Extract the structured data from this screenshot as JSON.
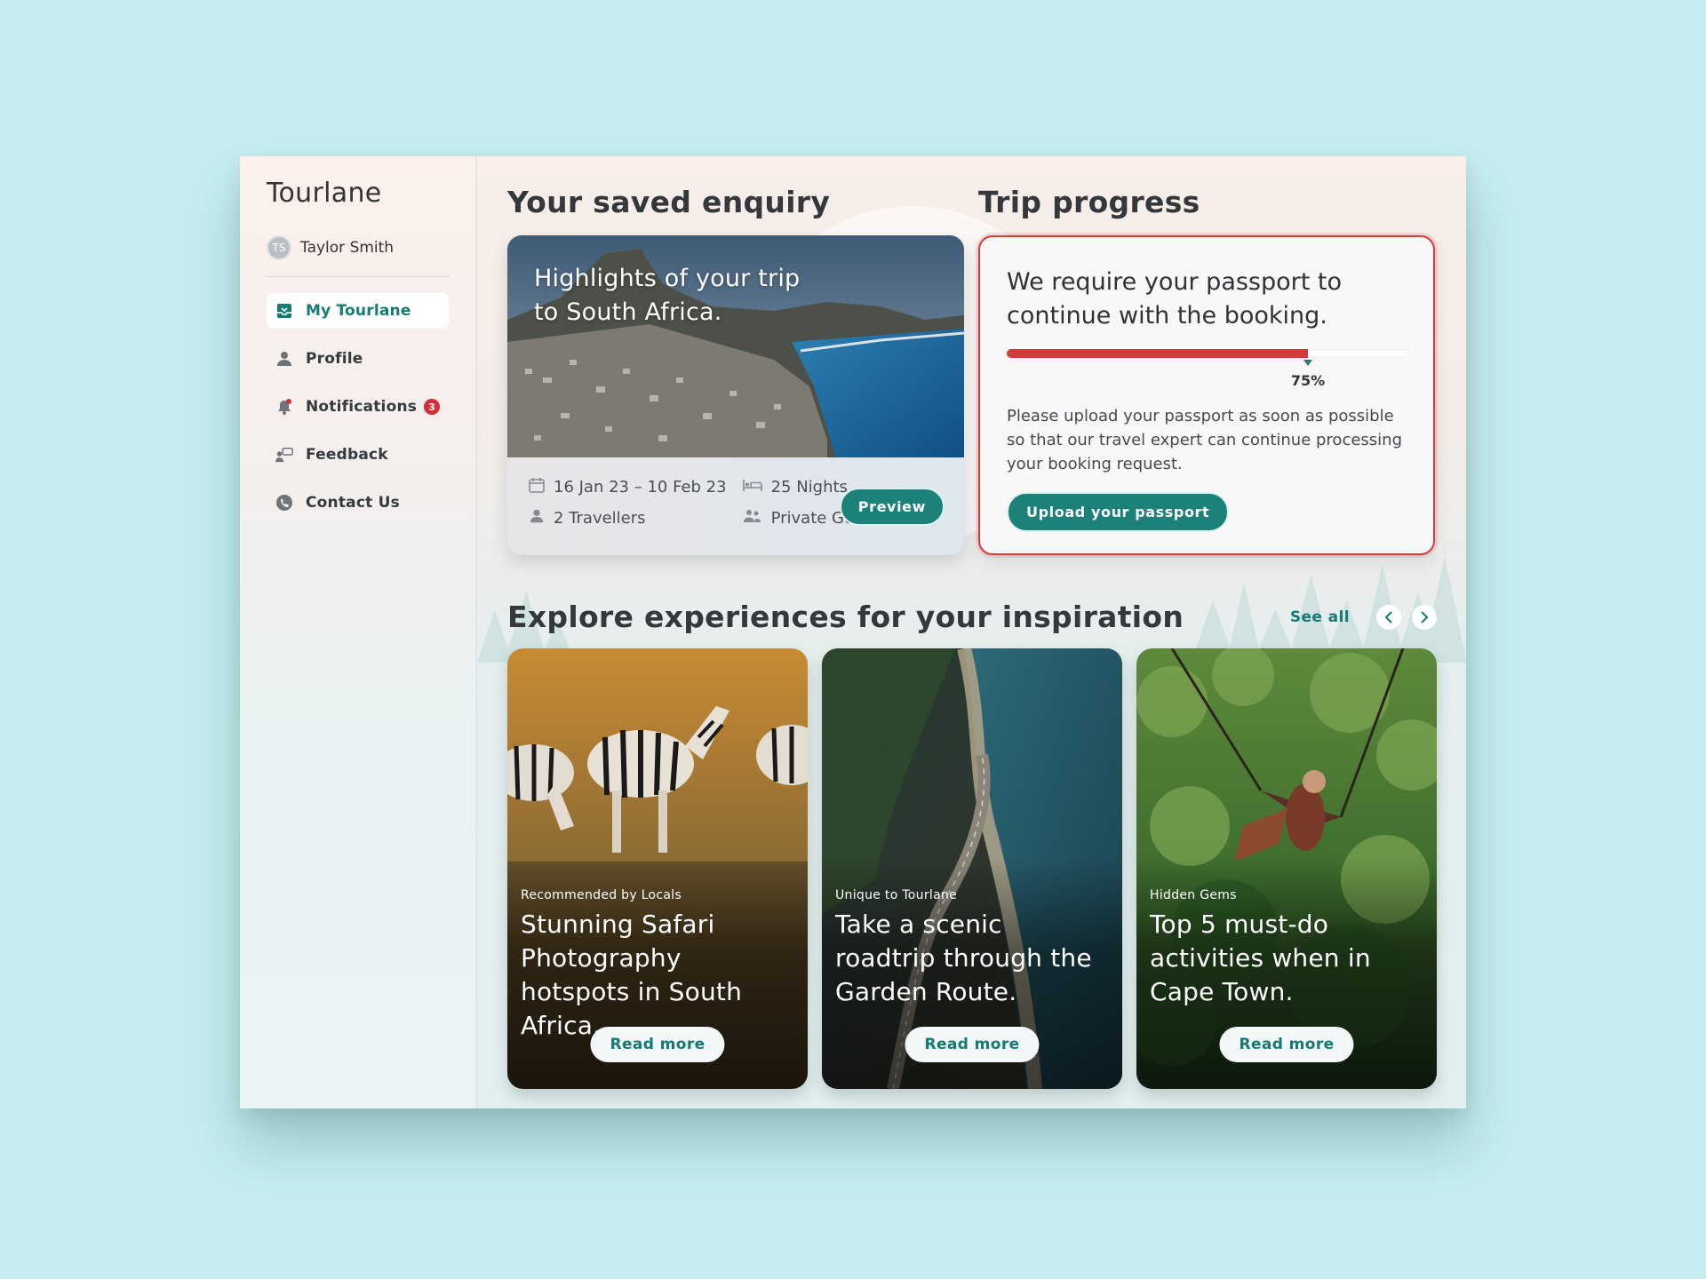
{
  "sidebar": {
    "brand": "Tourlane",
    "user": {
      "initials": "TS",
      "name": "Taylor Smith"
    },
    "items": [
      {
        "label": "My Tourlane",
        "icon": "inbox-icon",
        "active": true
      },
      {
        "label": "Profile",
        "icon": "user-icon",
        "active": false
      },
      {
        "label": "Notifications",
        "icon": "bell-icon",
        "active": false,
        "badge": "3"
      },
      {
        "label": "Feedback",
        "icon": "feedback-icon",
        "active": false
      },
      {
        "label": "Contact Us",
        "icon": "phone-icon",
        "active": false
      }
    ]
  },
  "enquiry": {
    "section_title": "Your saved enquiry",
    "heading": "Highlights of your trip to South Africa.",
    "dates": "16 Jan 23 – 10 Feb 23",
    "nights": "25 Nights",
    "travellers": "2 Travellers",
    "tour_type": "Private Guided",
    "preview_label": "Preview"
  },
  "trip": {
    "section_title": "Trip progress",
    "heading": "We require your passport to continue with the booking.",
    "progress_value": 0.75,
    "progress_label": "75%",
    "body": "Please upload your passport as soon as possible so that our travel expert can continue processing your booking request.",
    "upload_label": "Upload your passport"
  },
  "explore": {
    "section_title": "Explore experiences for your inspiration",
    "see_all": "See all",
    "cards": [
      {
        "tag": "Recommended by Locals",
        "title": "Stunning Safari Photography hotspots in South Africa.",
        "button": "Read more"
      },
      {
        "tag": "Unique to Tourlane",
        "title": "Take a scenic roadtrip through the Garden Route.",
        "button": "Read more"
      },
      {
        "tag": "Hidden Gems",
        "title": "Top 5 must-do activities when in Cape Town.",
        "button": "Read more"
      }
    ]
  },
  "colors": {
    "accent": "#1b8179",
    "alert": "#d33a3a",
    "background": "#c6eef0"
  }
}
